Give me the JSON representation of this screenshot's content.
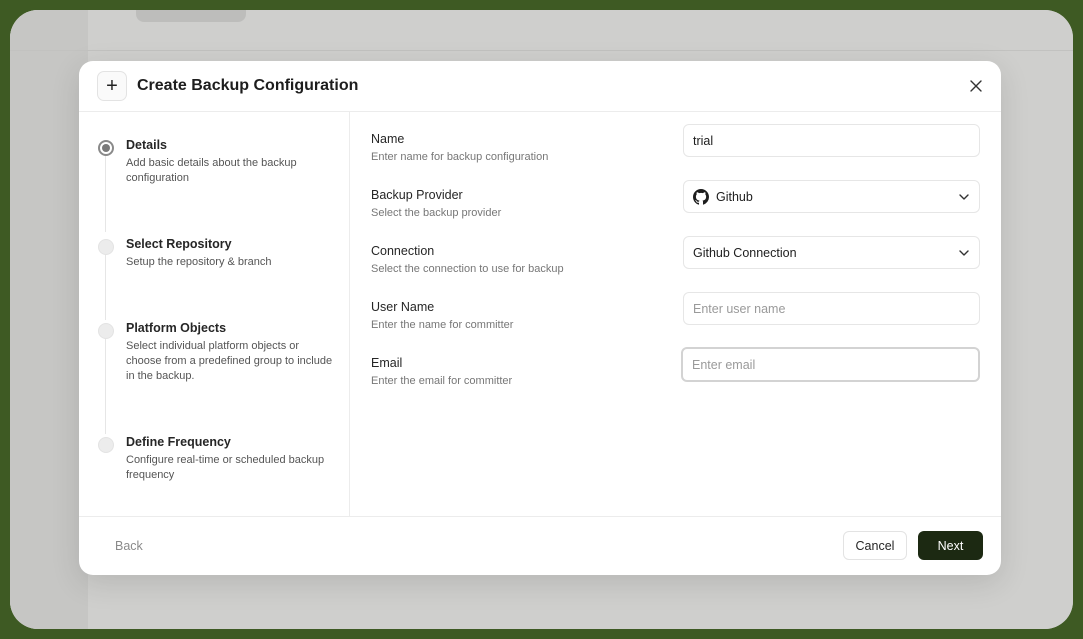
{
  "colors": {
    "accent": "#1c2912",
    "outer_background": "#3e5a23",
    "overlay": "#cfcfcd"
  },
  "modal": {
    "title": "Create Backup Configuration",
    "header_icon": "plus-icon",
    "close_icon": "close-icon"
  },
  "steps": [
    {
      "title": "Details",
      "desc": "Add basic details about the backup configuration",
      "state": "active"
    },
    {
      "title": "Select Repository",
      "desc": "Setup the repository & branch",
      "state": "pending"
    },
    {
      "title": "Platform Objects",
      "desc": "Select individual platform objects or choose from a predefined group to include in the backup.",
      "state": "pending"
    },
    {
      "title": "Define Frequency",
      "desc": "Configure real-time or scheduled backup frequency",
      "state": "pending"
    }
  ],
  "form": {
    "name": {
      "label": "Name",
      "help": "Enter name for backup configuration",
      "value": "trial"
    },
    "provider": {
      "label": "Backup Provider",
      "help": "Select the backup provider",
      "value": "Github",
      "icon": "github-icon"
    },
    "connection": {
      "label": "Connection",
      "help": "Select the connection to use for backup",
      "value": "Github Connection"
    },
    "user_name": {
      "label": "User Name",
      "help": "Enter the name for committer",
      "placeholder": "Enter user name"
    },
    "email": {
      "label": "Email",
      "help": "Enter the email for committer",
      "placeholder": "Enter email"
    }
  },
  "footer": {
    "back_label": "Back",
    "cancel_label": "Cancel",
    "next_label": "Next"
  }
}
